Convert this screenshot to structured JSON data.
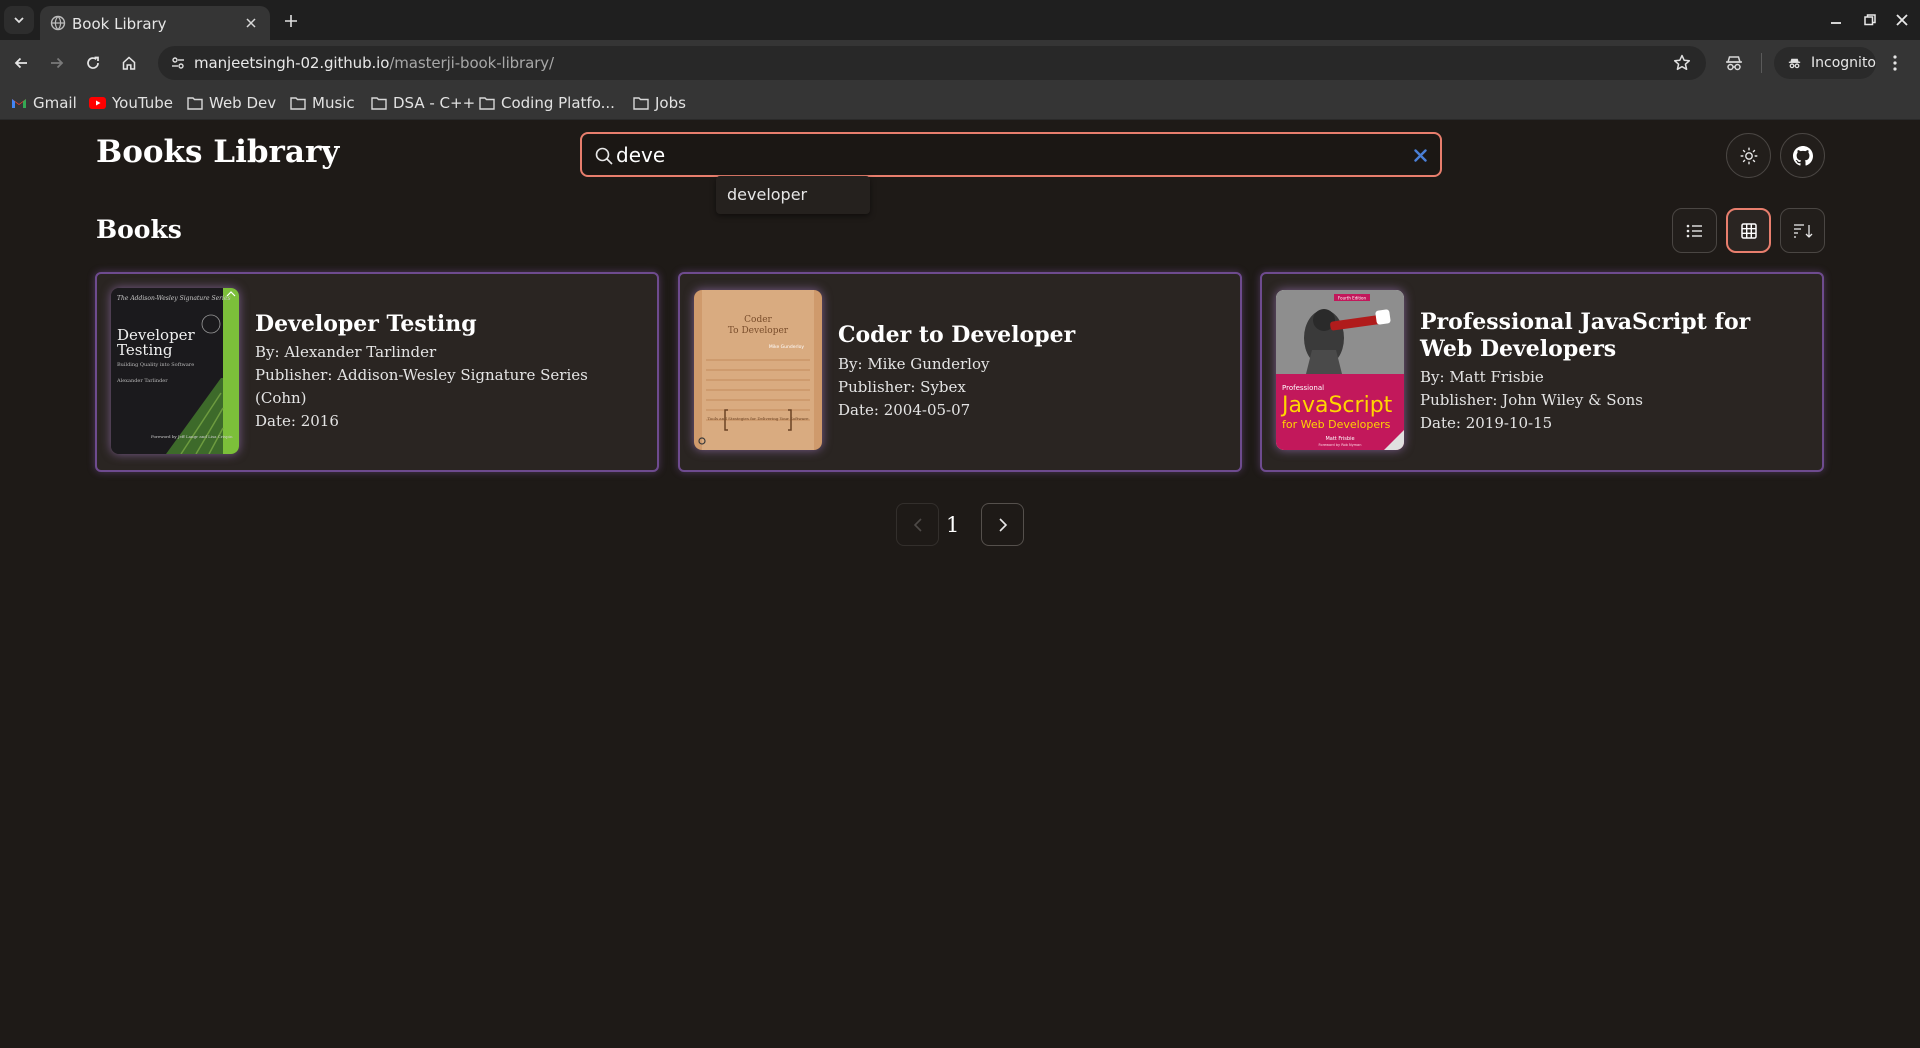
{
  "browser": {
    "tab_title": "Book Library",
    "url_host": "manjeetsingh-02.github.io",
    "url_path": "/masterji-book-library/",
    "incognito_label": "Incognito",
    "bookmarks": [
      {
        "label": "Gmail",
        "icon": "gmail-icon"
      },
      {
        "label": "YouTube",
        "icon": "youtube-icon"
      },
      {
        "label": "Web Dev",
        "icon": "folder-icon"
      },
      {
        "label": "Music",
        "icon": "folder-icon"
      },
      {
        "label": "DSA - C++",
        "icon": "folder-icon"
      },
      {
        "label": "Coding Platfo...",
        "icon": "folder-icon"
      },
      {
        "label": "Jobs",
        "icon": "folder-icon"
      }
    ]
  },
  "header": {
    "title": "Books Library",
    "search_value": "deve",
    "suggestion": "developer"
  },
  "section": {
    "title": "Books"
  },
  "books": [
    {
      "title": "Developer Testing",
      "author": "By: Alexander Tarlinder",
      "publisher": "Publisher: Addison-Wesley Signature Series (Cohn)",
      "date": "Date: 2016",
      "cover": {
        "series": "The Addison-Wesley Signature Series",
        "title_line1": "Developer",
        "title_line2": "Testing",
        "subtitle": "Building Quality into Software",
        "author": "Alexander Tarlinder",
        "foreword": "Foreword by Jeff Langr and Lisa Crispin"
      }
    },
    {
      "title": "Coder to Developer",
      "author": "By: Mike Gunderloy",
      "publisher": "Publisher: Sybex",
      "date": "Date: 2004-05-07",
      "cover": {
        "title_line1": "Coder",
        "title_line2": "To Developer",
        "author": "Mike Gunderloy",
        "tagline": "Tools and Strategies for Delivering Your Software"
      }
    },
    {
      "title": "Professional JavaScript for Web Developers",
      "author": "By: Matt Frisbie",
      "publisher": "Publisher: John Wiley & Sons",
      "date": "Date: 2019-10-15",
      "cover": {
        "edition": "Fourth Edition",
        "prefix": "Professional",
        "title": "JavaScript",
        "subtitle": "for Web Developers",
        "author": "Matt Frisbie",
        "foreword": "Foreword by Rob Nyman"
      }
    }
  ],
  "pagination": {
    "current": "1"
  },
  "colors": {
    "accent": "#e87e6d",
    "card_glow": "#6e4b8f",
    "background": "#1e1a17"
  }
}
